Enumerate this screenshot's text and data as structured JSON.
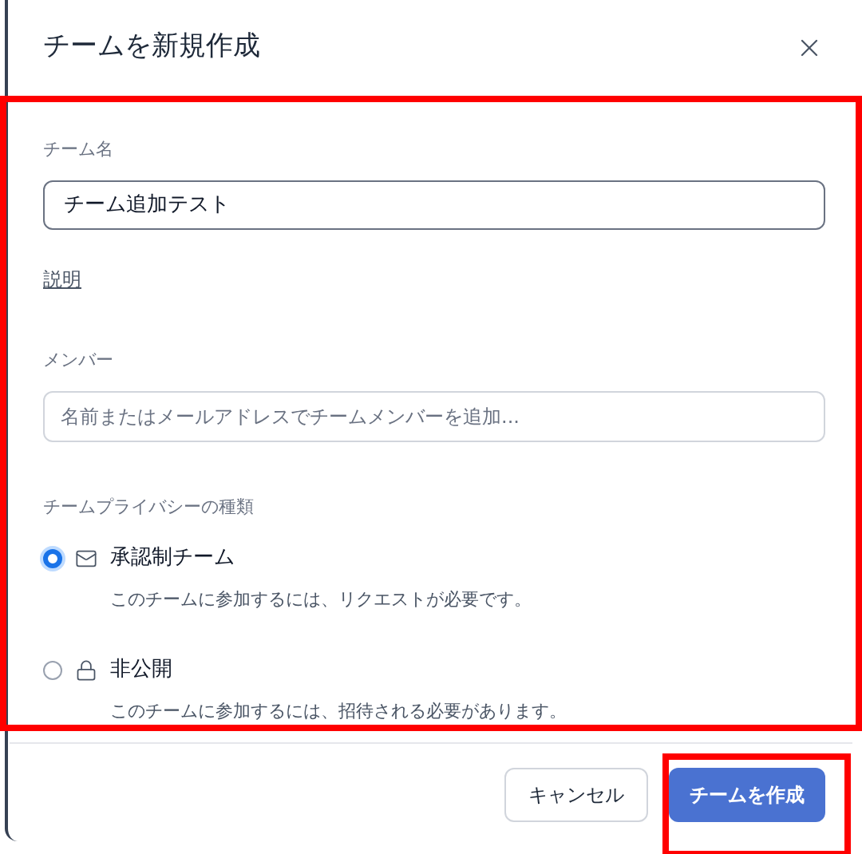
{
  "dialog": {
    "title": "チームを新規作成"
  },
  "team_name": {
    "label": "チーム名",
    "value": "チーム追加テスト"
  },
  "description_link": "説明",
  "members": {
    "label": "メンバー",
    "placeholder": "名前またはメールアドレスでチームメンバーを追加..."
  },
  "privacy": {
    "label": "チームプライバシーの種類",
    "options": [
      {
        "kind": "envelope",
        "title": "承認制チーム",
        "description": "このチームに参加するには、リクエストが必要です。",
        "selected": true
      },
      {
        "kind": "lock",
        "title": "非公開",
        "description": "このチームに参加するには、招待される必要があります。",
        "selected": false
      }
    ]
  },
  "buttons": {
    "cancel": "キャンセル",
    "create": "チームを作成"
  }
}
